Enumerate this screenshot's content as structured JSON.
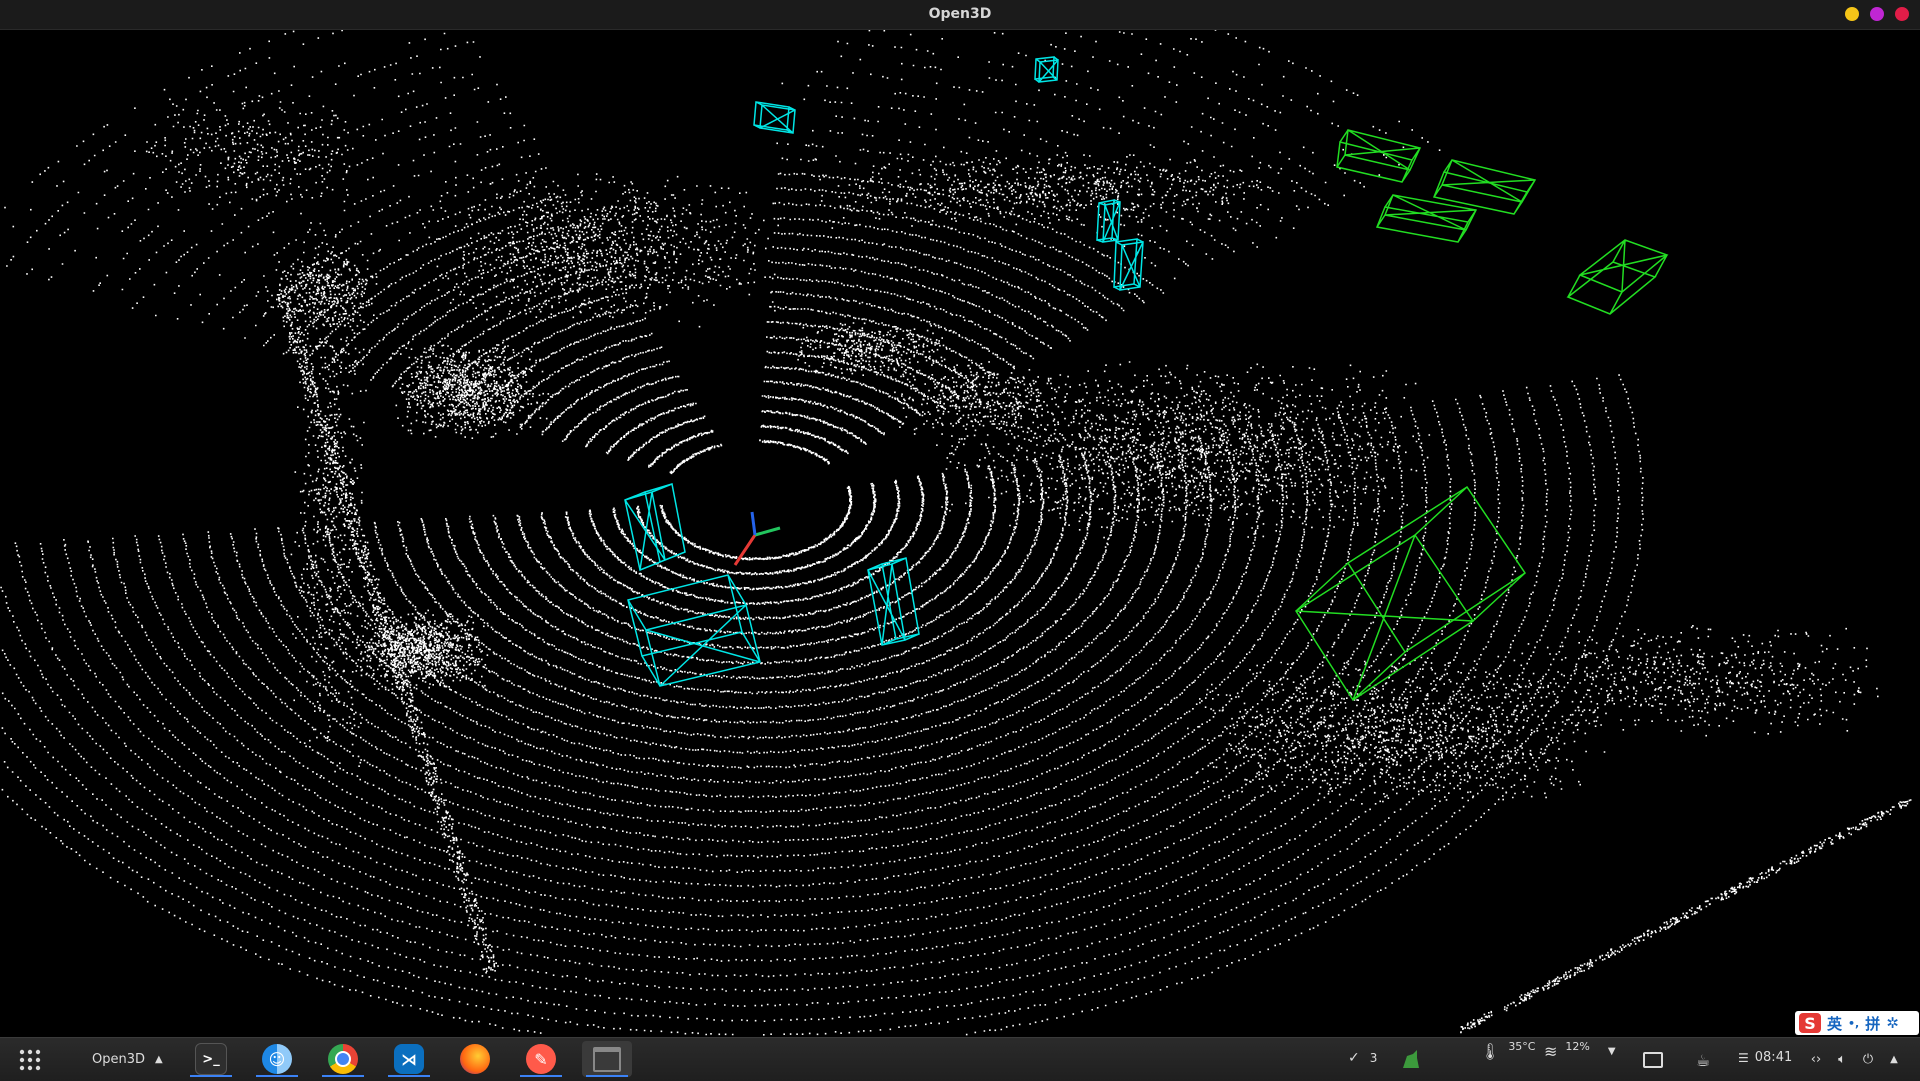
{
  "window": {
    "title": "Open3D",
    "controls": [
      {
        "name": "minimize-button",
        "color": "#f5c518"
      },
      {
        "name": "maximize-button",
        "color": "#c026d3"
      },
      {
        "name": "close-button",
        "color": "#e11d48"
      }
    ]
  },
  "scene": {
    "background": "#000000",
    "point_color": "#ffffff",
    "box_colors": {
      "cyan": "#00e5e5",
      "green": "#22dd22"
    },
    "axes_colors": {
      "x": "#e53935",
      "y": "#22c55e",
      "z": "#2563eb"
    }
  },
  "ime": {
    "logo": "S",
    "mode_label": "英",
    "punct": "•,",
    "pinyin_label": "拼"
  },
  "taskbar": {
    "active_window_label": "Open3D",
    "apps": [
      "launcher-icon",
      "terminal-icon",
      "finder-icon",
      "chrome-icon",
      "vscode-icon",
      "firefox-icon",
      "editor-icon",
      "window-icon"
    ],
    "tray": {
      "check_count": "3",
      "temperature": "35°C",
      "disk_usage": "12%",
      "clock": "08:41"
    }
  }
}
